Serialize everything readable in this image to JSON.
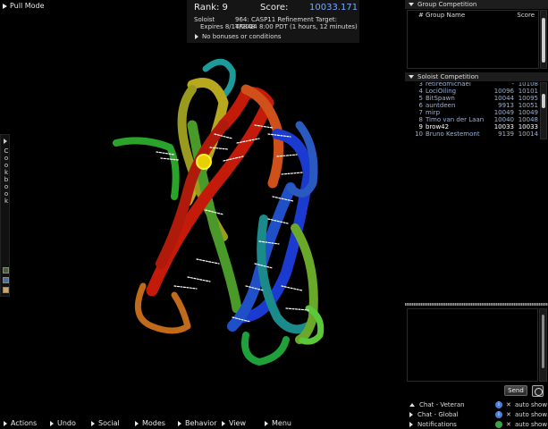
{
  "pull_mode": {
    "label": "Pull Mode"
  },
  "score": {
    "rank_text": "Rank: 9",
    "score_label": "Score:",
    "score_value": "10033.171",
    "role": "Soloist",
    "target": "964: CASP11 Refinement Target: TR848",
    "expires": "Expires 8/14/2014 8:00 PDT (1 hours, 12 minutes)",
    "bonus": "No bonuses or conditions"
  },
  "cookbook": {
    "label": "Cookbook"
  },
  "group_competition": {
    "title": "Group Competition",
    "col_num": "#",
    "col_name": "Group Name",
    "col_score": "Score"
  },
  "soloist_competition": {
    "title": "Soloist Competition",
    "rows": [
      {
        "rank": "3",
        "name": "retiredmichael",
        "score": "-",
        "best": "10108"
      },
      {
        "rank": "4",
        "name": "LociOiling",
        "score": "10096",
        "best": "10101"
      },
      {
        "rank": "5",
        "name": "BitSpawn",
        "score": "10044",
        "best": "10095"
      },
      {
        "rank": "6",
        "name": "auntdeen",
        "score": "9913",
        "best": "10051"
      },
      {
        "rank": "7",
        "name": "mirp",
        "score": "10049",
        "best": "10049"
      },
      {
        "rank": "8",
        "name": "Timo van der Laan",
        "score": "10040",
        "best": "10048"
      },
      {
        "rank": "9",
        "name": "brow42",
        "score": "10033",
        "best": "10033"
      },
      {
        "rank": "10",
        "name": "Bruno Kestemont",
        "score": "9139",
        "best": "10014"
      }
    ]
  },
  "chat": {
    "send_label": "Send",
    "channels": [
      {
        "label": "Chat - Veteran",
        "info": "i",
        "auto": "auto show"
      },
      {
        "label": "Chat - Global",
        "info": "i",
        "auto": "auto show"
      },
      {
        "label": "Notifications",
        "info": "",
        "auto": "auto show"
      }
    ]
  },
  "bottom_menu": [
    "Actions",
    "Undo",
    "Social",
    "Modes",
    "Behavior",
    "View",
    "Menu"
  ],
  "colors": {
    "score_value": "#7aa7ff",
    "soloist_text": "#9db1d6",
    "highlight_row": "#ffffff",
    "info_blue": "#4a7fd8",
    "info_green": "#3aa34a"
  }
}
